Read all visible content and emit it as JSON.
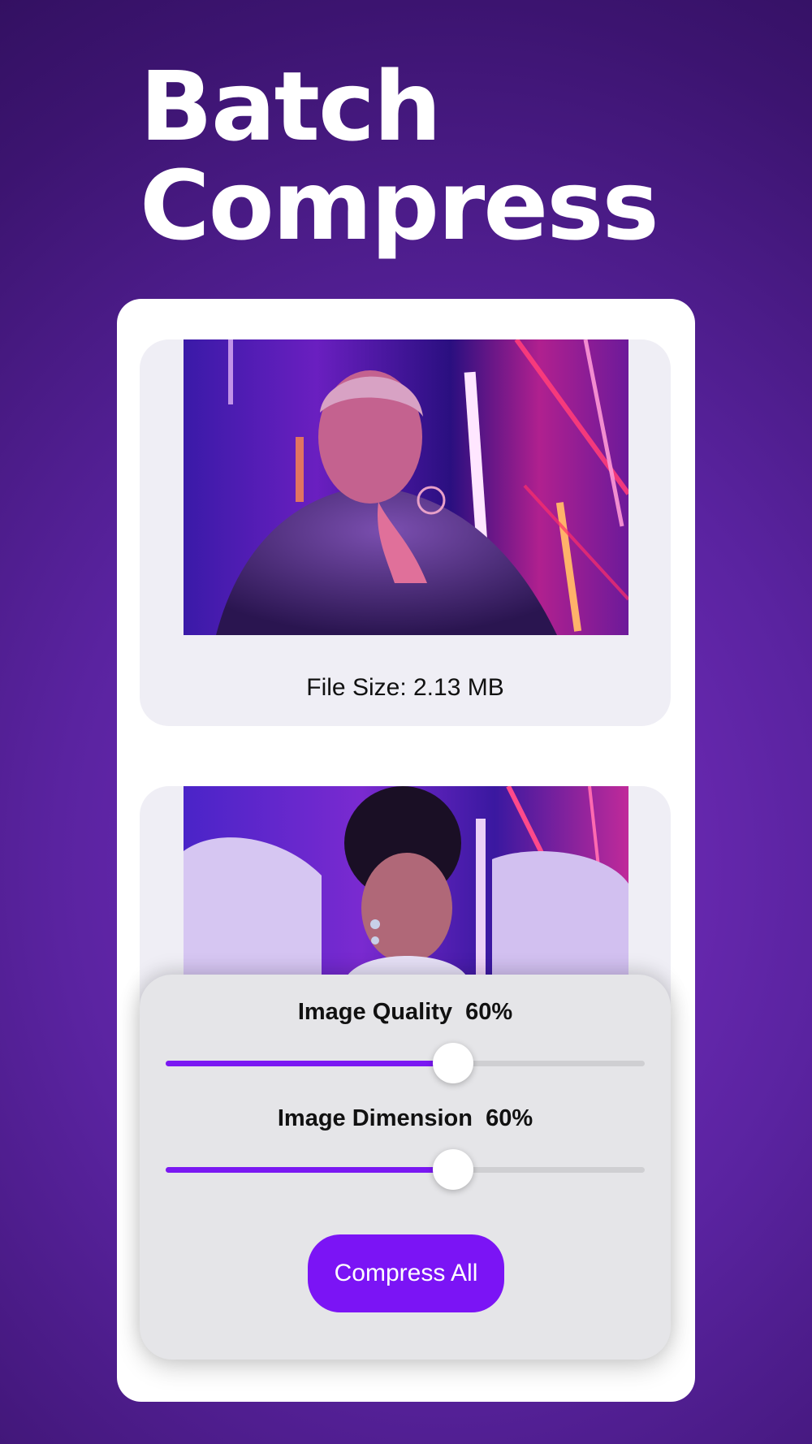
{
  "headline": {
    "line1": "Batch",
    "line2": "Compress"
  },
  "images": [
    {
      "file_size_label": "File Size: 2.13 MB"
    },
    {
      "file_size_label": ""
    }
  ],
  "controls": {
    "quality_label": "Image Quality  60%",
    "quality_value": 0.6,
    "dimension_label": "Image Dimension  60%",
    "dimension_value": 0.6
  },
  "compress_button_label": "Compress All",
  "colors": {
    "accent": "#7b14f5",
    "background_dark": "#2b0d55",
    "tile_background": "#efeef5",
    "panel_background": "#e5e5e8"
  }
}
